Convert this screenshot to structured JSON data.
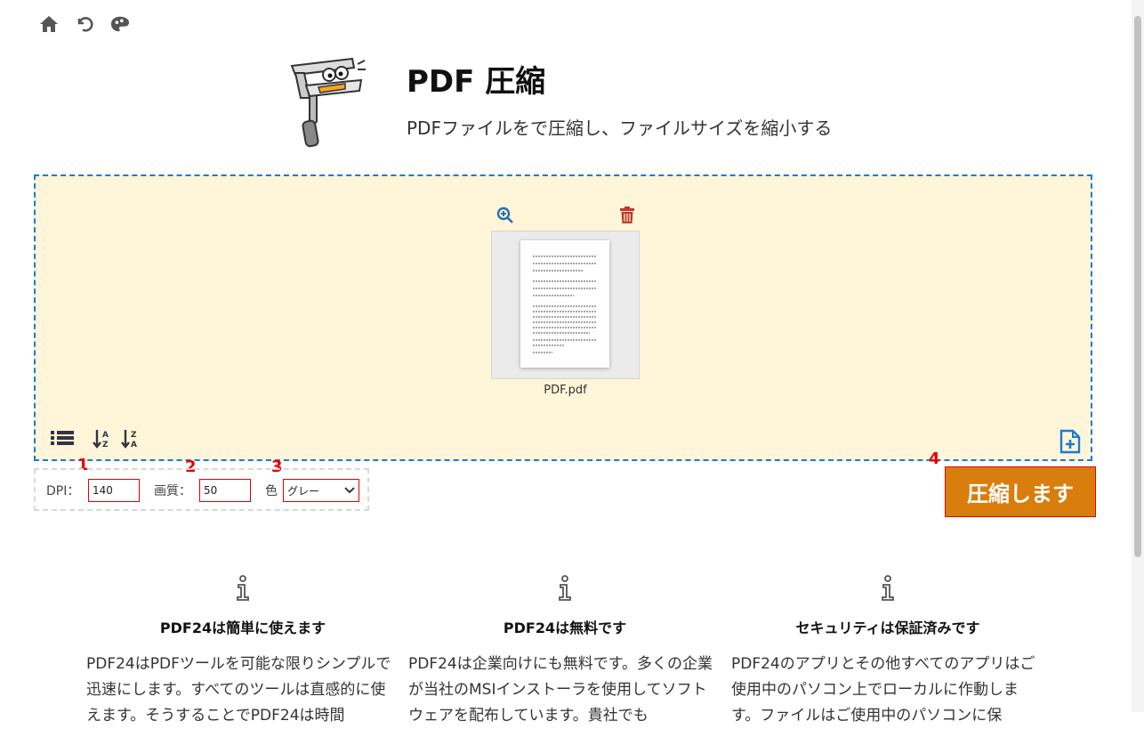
{
  "app": {
    "title": "PDF 圧縮",
    "subtitle": "PDFファイルをで圧縮し、ファイルサイズを縮小する"
  },
  "file": {
    "name": "PDF.pdf"
  },
  "settings": {
    "dpi_label": "DPI：",
    "dpi_value": "140",
    "quality_label": "画質：",
    "quality_value": "50",
    "color_label": "色",
    "color_value": "グレー"
  },
  "markers": [
    "1",
    "2",
    "3",
    "4"
  ],
  "compress_button": "圧縮します",
  "info": [
    {
      "heading": "PDF24は簡単に使えます",
      "text": "PDF24はPDFツールを可能な限りシンプルで迅速にします。すべてのツールは直感的に使えます。そうすることでPDF24は時間"
    },
    {
      "heading": "PDF24は無料です",
      "text": "PDF24は企業向けにも無料です。多くの企業が当社のMSIインストーラを使用してソフトウェアを配布しています。貴社でも"
    },
    {
      "heading": "セキュリティは保証済みです",
      "text": "PDF24のアプリとその他すべてのアプリはご使用中のパソコン上でローカルに作動します。ファイルはご使用中のパソコンに保"
    }
  ],
  "colors": {
    "accent": "#d97d0d",
    "drop_border": "#1a7bd1",
    "drop_bg": "#fff5d8",
    "marker": "#e60000"
  }
}
